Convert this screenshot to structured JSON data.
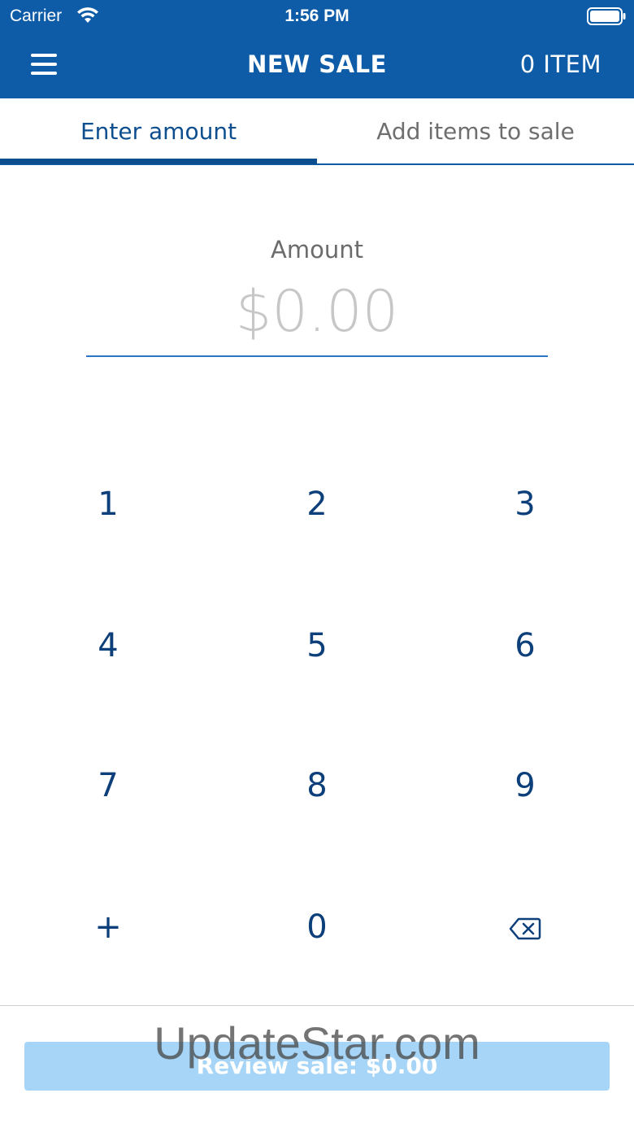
{
  "status_bar": {
    "carrier": "Carrier",
    "time": "1:56 PM"
  },
  "nav": {
    "title": "NEW SALE",
    "item_count": "0 ITEM"
  },
  "tabs": [
    {
      "label": "Enter amount",
      "active": true
    },
    {
      "label": "Add items to sale",
      "active": false
    }
  ],
  "amount": {
    "label": "Amount",
    "value": "$0.00"
  },
  "keypad": {
    "keys": [
      "1",
      "2",
      "3",
      "4",
      "5",
      "6",
      "7",
      "8",
      "9",
      "+",
      "0"
    ],
    "backspace_icon": "backspace-icon"
  },
  "footer": {
    "review_label": "Review sale: $0.00"
  },
  "watermark": "UpdateStar.com",
  "colors": {
    "header": "#0e5ca8",
    "accent": "#0d4e8f",
    "button_disabled": "#a7d5f7"
  }
}
